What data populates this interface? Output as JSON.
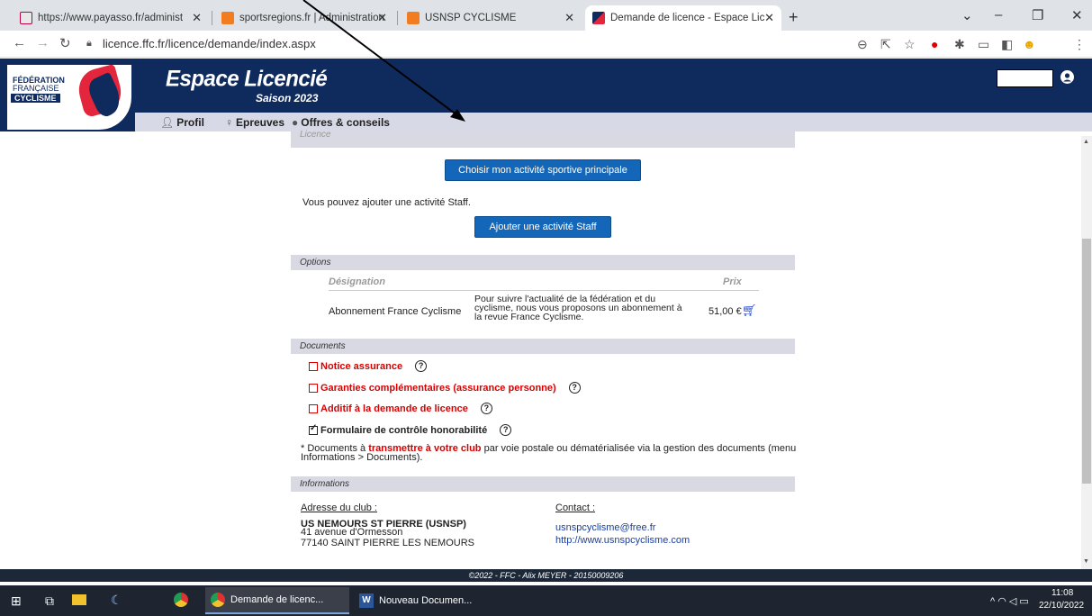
{
  "browser": {
    "tabs": [
      {
        "title": "https://www.payasso.fr/administ",
        "active": false
      },
      {
        "title": "sportsregions.fr | Administration",
        "active": false
      },
      {
        "title": "USNSP CYCLISME",
        "active": false
      },
      {
        "title": "Demande de licence - Espace Lic",
        "active": true
      }
    ],
    "url": "licence.ffc.fr/licence/demande/index.aspx"
  },
  "site": {
    "logo_line1": "FÉDÉRATION",
    "logo_line2": "FRANÇAISE",
    "logo_line3": "CYCLISME",
    "title": "Espace Licencié",
    "season": "Saison 2023",
    "menu": [
      {
        "label": "Profil",
        "icon": "person-icon"
      },
      {
        "label": "Epreuves",
        "icon": "medal-icon"
      },
      {
        "label": "Offres & conseils",
        "icon": "chat-icon"
      }
    ]
  },
  "licence": {
    "section_label": "Licence",
    "main_activity_button": "Choisir mon activité sportive principale",
    "staff_text": "Vous pouvez ajouter une activité Staff.",
    "staff_button": "Ajouter une activité Staff"
  },
  "options": {
    "section_label": "Options",
    "headers": {
      "designation": "Désignation",
      "price": "Prix"
    },
    "rows": [
      {
        "name": "Abonnement France Cyclisme",
        "description_lines": [
          "Pour suivre l'actualité de la fédération et du",
          "cyclisme, nous vous proposons un abonnement à",
          "la revue France Cyclisme."
        ],
        "price": "51,00 €"
      }
    ]
  },
  "documents": {
    "section_label": "Documents",
    "items": [
      {
        "label": "Notice assurance",
        "checked": false
      },
      {
        "label": "Garanties complémentaires (assurance personne)",
        "checked": false
      },
      {
        "label": "Additif à la demande de licence",
        "checked": false
      },
      {
        "label": "Formulaire de contrôle honorabilité",
        "checked": true
      }
    ],
    "note_prefix": "* Documents à ",
    "note_highlight": "transmettre à votre club",
    "note_suffix": " par voie postale ou dématérialisée via la gestion des documents (menu",
    "note_line2": "Informations > Documents)."
  },
  "informations": {
    "section_label": "Informations",
    "club_heading": "Adresse du club :",
    "club_name": "US NEMOURS ST PIERRE (USNSP)",
    "club_address1": "41 avenue d'Ormesson",
    "club_address2": "77140 SAINT PIERRE LES NEMOURS",
    "contact_heading": "Contact :",
    "contact_email": "usnspcyclisme@free.fr",
    "contact_web": "http://www.usnspcyclisme.com"
  },
  "footer": "©2022 - FFC - Alix MEYER - 20150009206",
  "taskbar": {
    "items": [
      "Demande de licenc...",
      "Nouveau Documen..."
    ],
    "time": "11:08",
    "date": "22/10/2022"
  }
}
